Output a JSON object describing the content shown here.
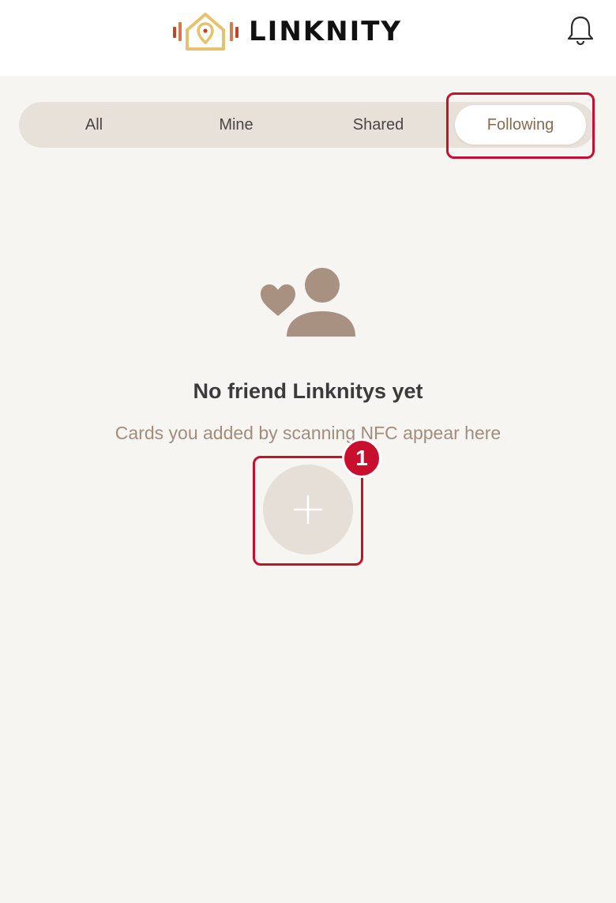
{
  "header": {
    "brand_name": "LINKNITY",
    "logo_icon": "house-pin-icon",
    "notification_icon": "bell-icon"
  },
  "tabs": [
    {
      "label": "All",
      "selected": false
    },
    {
      "label": "Mine",
      "selected": false
    },
    {
      "label": "Shared",
      "selected": false
    },
    {
      "label": "Following",
      "selected": true
    }
  ],
  "empty_state": {
    "icon": "heart-person-icon",
    "title": "No friend Linknitys yet",
    "subtitle": "Cards you added by scanning NFC appear here"
  },
  "add_button": {
    "icon": "plus-icon"
  },
  "annotation": {
    "step_number": "1",
    "highlight_color": "#c8102e"
  },
  "colors": {
    "background": "#f7f5f2",
    "tab_track": "#e8e1da",
    "accent_brown": "#a28c7c",
    "icon_brown": "#a89181",
    "logo_gold": "#e5c36e",
    "logo_red": "#c0452b"
  }
}
